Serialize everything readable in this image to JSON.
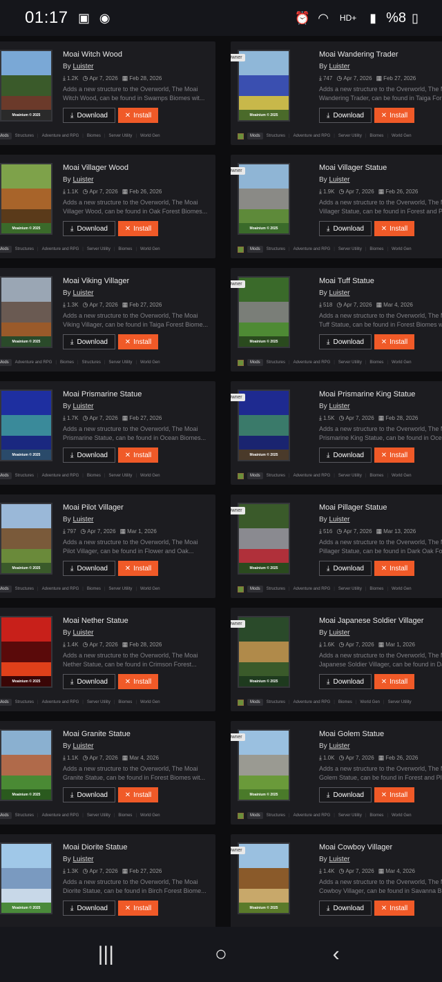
{
  "status_bar": {
    "time": "01:17",
    "battery": "%8"
  },
  "actions": {
    "download_label": "Download",
    "install_label": "Install"
  },
  "owner_badge": "Owner",
  "by_label": "By",
  "mods_tag": "Mods",
  "thumb_watermark": "Moainium © 2025",
  "mods": [
    {
      "title": "Moai Witch Wood",
      "author": "Luister",
      "downloads": "1.2K",
      "created": "Apr 7, 2026",
      "updated": "Feb 28, 2026",
      "desc1": "Adds a new structure to the Overworld, The Moai",
      "desc2": "Witch Wood, can be found in Swamps Biomes wit...",
      "tags": [
        "Structures",
        "Adventure and RPG",
        "Biomes",
        "Server Utility",
        "World Gen"
      ],
      "colors": [
        "#7aa8d6",
        "#3a5a2a",
        "#6b3a2a",
        "#2a2a2a"
      ]
    },
    {
      "title": "Moai Wandering Trader",
      "author": "Luister",
      "downloads": "747",
      "created": "Apr 7, 2026",
      "updated": "Feb 27, 2026",
      "desc1": "Adds a new structure to the Overworld, The Moai",
      "desc2": "Wandering Trader, can be found in Taiga Forest",
      "tags": [
        "Structures",
        "Adventure and RPG",
        "Server Utility",
        "Biomes",
        "World Gen"
      ],
      "colors": [
        "#8fb7d8",
        "#3a4fb0",
        "#c8b84a",
        "#4a6a2a"
      ]
    },
    {
      "title": "Moai Villager Wood",
      "author": "Luister",
      "downloads": "1.1K",
      "created": "Apr 7, 2026",
      "updated": "Feb 26, 2026",
      "desc1": "Adds a new structure to the Overworld, The Moai",
      "desc2": "Villager Wood, can be found in Oak Forest Biomes...",
      "tags": [
        "Structures",
        "Adventure and RPG",
        "Server Utility",
        "Biomes",
        "World Gen"
      ],
      "colors": [
        "#7ea24a",
        "#a8642a",
        "#5a3a1a",
        "#3a6a2a"
      ]
    },
    {
      "title": "Moai Villager Statue",
      "author": "Luister",
      "downloads": "1.9K",
      "created": "Apr 7, 2026",
      "updated": "Feb 26, 2026",
      "desc1": "Adds a new structure to the Overworld, The Moai",
      "desc2": "Villager Statue, can be found in Forest and Plains",
      "tags": [
        "Structures",
        "Adventure and RPG",
        "Server Utility",
        "Biomes",
        "World Gen"
      ],
      "colors": [
        "#8fb5d5",
        "#8a8a86",
        "#5e8a3a",
        "#3a6a2a"
      ]
    },
    {
      "title": "Moai Viking Villager",
      "author": "Luister",
      "downloads": "1.3K",
      "created": "Apr 7, 2026",
      "updated": "Feb 27, 2026",
      "desc1": "Adds a new structure to the Overworld, The Moai",
      "desc2": "Viking Villager, can be found in Taiga Forest Biome...",
      "tags": [
        "Adventure and RPG",
        "Biomes",
        "Structures",
        "Server Utility",
        "World Gen"
      ],
      "colors": [
        "#9aa6b4",
        "#6a5a52",
        "#9a5a2a",
        "#2a4a2a"
      ]
    },
    {
      "title": "Moai Tuff Statue",
      "author": "Luister",
      "downloads": "518",
      "created": "Apr 7, 2026",
      "updated": "Mar 4, 2026",
      "desc1": "Adds a new structure to the Overworld, The Moai",
      "desc2": "Tuff Statue, can be found in Forest Biomes with",
      "tags": [
        "Structures",
        "Adventure and RPG",
        "Server Utility",
        "Biomes",
        "World Gen"
      ],
      "colors": [
        "#3a6a2a",
        "#7a7e78",
        "#4e8a34",
        "#2a4a1e"
      ]
    },
    {
      "title": "Moai Prismarine Statue",
      "author": "Luister",
      "downloads": "1.7K",
      "created": "Apr 7, 2026",
      "updated": "Feb 27, 2026",
      "desc1": "Adds a new structure to the Overworld, The Moai",
      "desc2": "Prismarine Statue, can be found in Ocean Biomes...",
      "tags": [
        "Structures",
        "Adventure and RPG",
        "Biomes",
        "Server Utility",
        "World Gen"
      ],
      "colors": [
        "#1e2fa0",
        "#3a8a9a",
        "#1a2880",
        "#2a4a6a"
      ]
    },
    {
      "title": "Moai Prismarine King Statue",
      "author": "Luister",
      "downloads": "1.5K",
      "created": "Apr 7, 2026",
      "updated": "Feb 28, 2026",
      "desc1": "Adds a new structure to the Overworld, The Moai",
      "desc2": "Prismarine King Statue, can be found in Ocean",
      "tags": [
        "Structures",
        "Adventure and RPG",
        "Server Utility",
        "Biomes",
        "World Gen"
      ],
      "colors": [
        "#1e2a90",
        "#3a7a6a",
        "#1a2470",
        "#4a3a2a"
      ]
    },
    {
      "title": "Moai Pilot Villager",
      "author": "Luister",
      "downloads": "797",
      "created": "Apr 7, 2026",
      "updated": "Mar 1, 2026",
      "desc1": "Adds a new structure to the Overworld, The Moai",
      "desc2": "Pilot Villager, can be found in Flower and Oak...",
      "tags": [
        "Structures",
        "Adventure and RPG",
        "Biomes",
        "Server Utility",
        "World Gen"
      ],
      "colors": [
        "#9ab8d8",
        "#7a5a3a",
        "#6a8a3a",
        "#3a5a2a"
      ]
    },
    {
      "title": "Moai Pillager Statue",
      "author": "Luister",
      "downloads": "516",
      "created": "Apr 7, 2026",
      "updated": "Mar 13, 2026",
      "desc1": "Adds a new structure to the Overworld, The Moai",
      "desc2": "Pillager Statue, can be found in Dark Oak Forest",
      "tags": [
        "Structures",
        "Adventure and RPG",
        "Server Utility",
        "Biomes",
        "World Gen"
      ],
      "colors": [
        "#3a5a2a",
        "#8a8a90",
        "#b0303a",
        "#2a4a1e"
      ]
    },
    {
      "title": "Moai Nether Statue",
      "author": "Luister",
      "downloads": "1.4K",
      "created": "Apr 7, 2026",
      "updated": "Feb 28, 2026",
      "desc1": "Adds a new structure to the Overworld, The Moai",
      "desc2": "Nether Statue, can be found in Crimson Forest...",
      "tags": [
        "Structures",
        "Adventure and RPG",
        "Server Utility",
        "Biomes",
        "World Gen"
      ],
      "colors": [
        "#c8201a",
        "#5a0a0a",
        "#e0401a",
        "#3a0606"
      ]
    },
    {
      "title": "Moai Japanese Soldier Villager",
      "author": "Luister",
      "downloads": "1.6K",
      "created": "Apr 7, 2026",
      "updated": "Mar 1, 2026",
      "desc1": "Adds a new structure to the Overworld, The Moai",
      "desc2": "Japanese Soldier Villager, can be found in Dark Oak",
      "tags": [
        "Structures",
        "Adventure and RPG",
        "Biomes",
        "World Gen",
        "Server Utility"
      ],
      "colors": [
        "#2a4a2a",
        "#b08a4a",
        "#3a5a2a",
        "#1e3a1e"
      ]
    },
    {
      "title": "Moai Granite Statue",
      "author": "Luister",
      "downloads": "1.1K",
      "created": "Apr 7, 2026",
      "updated": "Mar 4, 2026",
      "desc1": "Adds a new structure to the Overworld, The Moai",
      "desc2": "Granite Statue, can be found in Forest Biomes wit...",
      "tags": [
        "Structures",
        "Adventure and RPG",
        "Server Utility",
        "Biomes",
        "World Gen"
      ],
      "colors": [
        "#8ab0d0",
        "#b06a4a",
        "#4a8a34",
        "#2a5a1e"
      ]
    },
    {
      "title": "Moai Golem Statue",
      "author": "Luister",
      "downloads": "1.0K",
      "created": "Apr 7, 2026",
      "updated": "Feb 26, 2026",
      "desc1": "Adds a new structure to the Overworld, The Moai",
      "desc2": "Golem Statue, can be found in Forest and Plains",
      "tags": [
        "Structures",
        "Adventure and RPG",
        "Server Utility",
        "Biomes",
        "World Gen"
      ],
      "colors": [
        "#9ac0e0",
        "#9a9a92",
        "#6a9a3a",
        "#4a7a2a"
      ]
    },
    {
      "title": "Moai Diorite Statue",
      "author": "Luister",
      "downloads": "1.3K",
      "created": "Apr 7, 2026",
      "updated": "Feb 27, 2026",
      "desc1": "Adds a new structure to the Overworld, The Moai",
      "desc2": "Diorite Statue, can be found in Birch Forest Biome...",
      "tags": [],
      "colors": [
        "#a0c8e8",
        "#7a9ac0",
        "#c8d8e8",
        "#4a8a3a"
      ]
    },
    {
      "title": "Moai Cowboy Villager",
      "author": "Luister",
      "downloads": "1.4K",
      "created": "Apr 7, 2026",
      "updated": "Mar 4, 2026",
      "desc1": "Adds a new structure to the Overworld, The Moai",
      "desc2": "Cowboy Villager, can be found in Savanna Biomes",
      "tags": [],
      "colors": [
        "#9ac0e0",
        "#8a5a2a",
        "#c8a86a",
        "#5a7a2a"
      ]
    }
  ]
}
